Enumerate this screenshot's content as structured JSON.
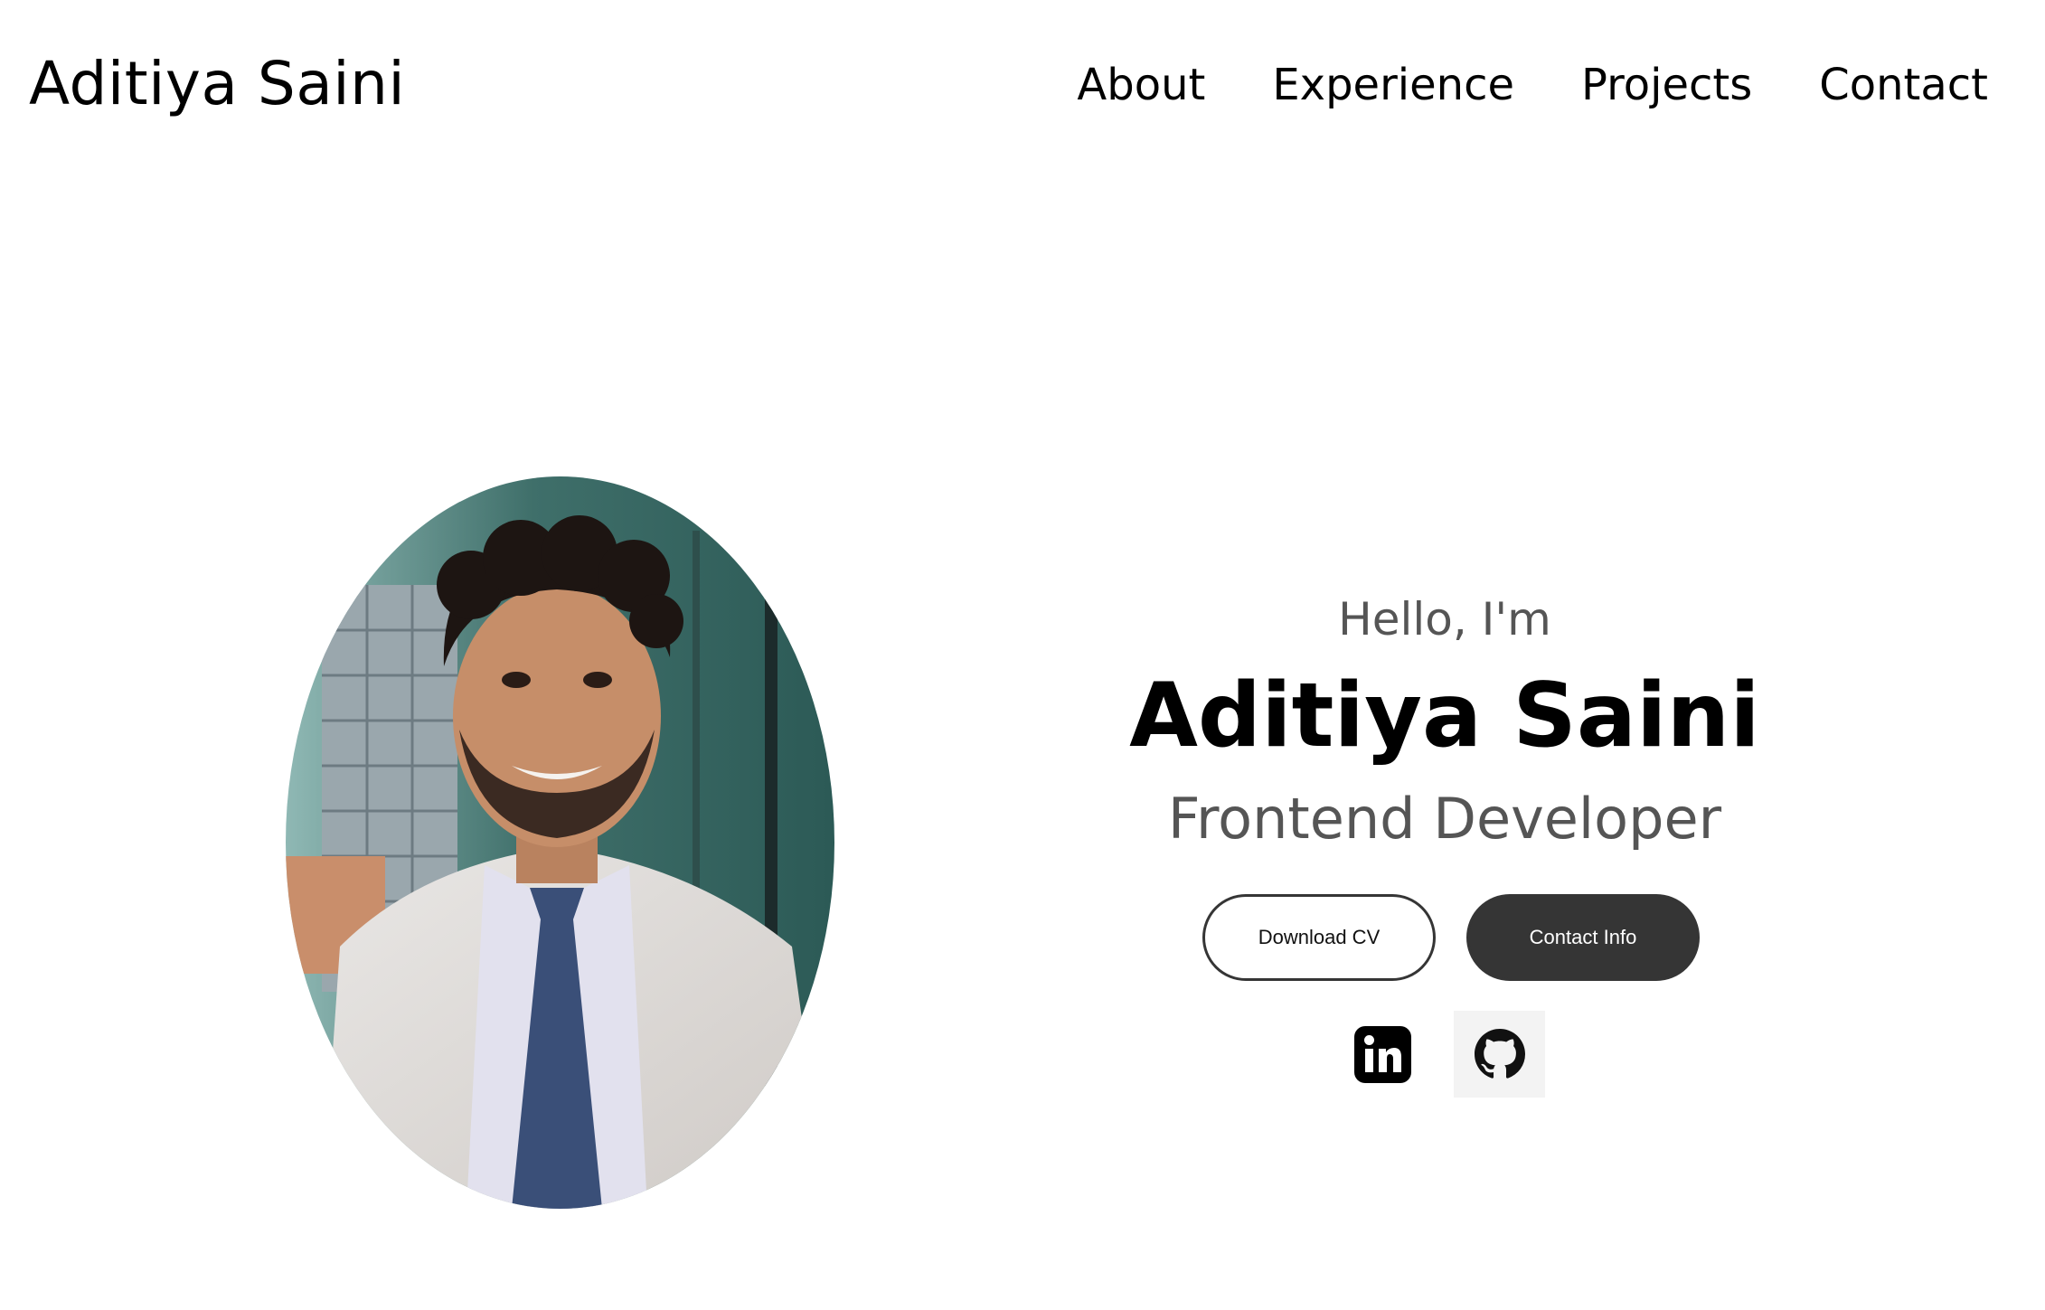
{
  "navbar": {
    "logo": "Aditiya Saini",
    "links": [
      "About",
      "Experience",
      "Projects",
      "Contact"
    ]
  },
  "hero": {
    "greeting": "Hello, I'm",
    "name": "Aditiya Saini",
    "title": "Frontend Developer",
    "buttons": {
      "download_cv": "Download CV",
      "contact_info": "Contact Info"
    },
    "socials": {
      "linkedin": "linkedin-icon",
      "github": "github-icon"
    }
  },
  "colors": {
    "text": "#000000",
    "muted_text": "#555555",
    "button_dark": "#353535",
    "background": "#ffffff"
  }
}
